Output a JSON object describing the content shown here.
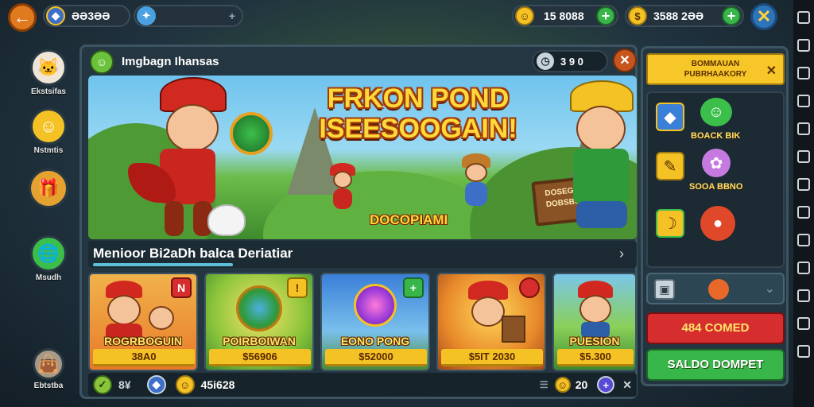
{
  "top_bar": {
    "profile_value": "ƏƏ3ƏƏ",
    "currency_gold": "15 8088",
    "currency_coins": "3588 2ƏƏ"
  },
  "sidebar": {
    "items": [
      {
        "label": "Ekstsifas"
      },
      {
        "label": "Nstmtis"
      },
      {
        "label": ""
      },
      {
        "label": "Msudh"
      },
      {
        "label": "Ebtstba"
      }
    ]
  },
  "panel": {
    "title": "Imgbagn Ihansas",
    "counter_value": "3  9 0"
  },
  "banner": {
    "title_line1": "FRKON POND",
    "title_line2": "ISEESOOGAIN!",
    "subtitle": "DOCOPIAMI",
    "sign_line1": "DOSEGS",
    "sign_line2": "DOBSBS"
  },
  "section": {
    "title": "Menioor Bi2aDh balca Deriatiar"
  },
  "cards": [
    {
      "label": "ROGRBOGUIN",
      "price": "38A0",
      "badge": "N"
    },
    {
      "label": "POIRBOIWAN",
      "price": "$56906",
      "badge": "!"
    },
    {
      "label": "EONO PONG",
      "price": "$52000",
      "badge": "+"
    },
    {
      "label": "",
      "price": "$5IT 2030",
      "badge": ""
    },
    {
      "label": "PUESION",
      "price": "$5.300",
      "badge": ""
    }
  ],
  "footer": {
    "left_value": "8¥",
    "mid_value": "45i628",
    "right_value": "20"
  },
  "right_panel": {
    "header_line1": "BOMMAUAN",
    "header_line2": "PUBRHAAKORY",
    "label_1": "BOACK BIK",
    "label_2": "SOOA BBNO",
    "red_button": "484 COMED",
    "green_button": "SALDO DOMPET"
  },
  "colors": {
    "accent_orange": "#e07a1f",
    "gold": "#f4c224",
    "green": "#39b64a",
    "red": "#d62e2e",
    "panel": "#243641"
  }
}
